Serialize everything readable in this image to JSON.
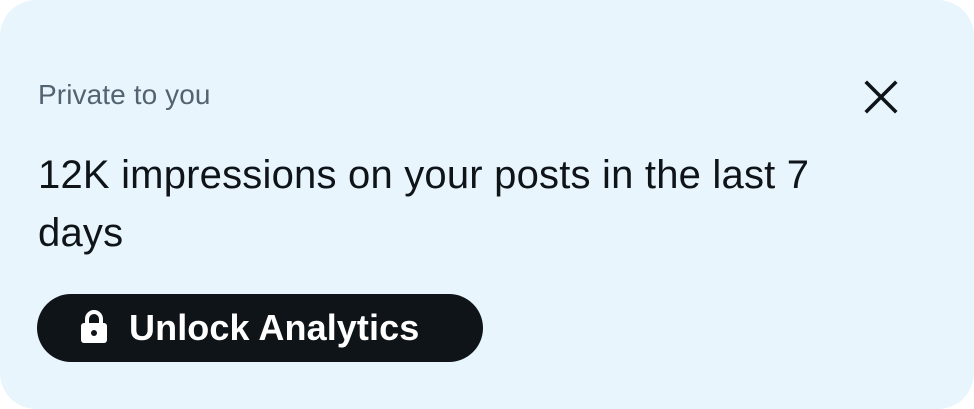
{
  "card": {
    "eyebrow": "Private to you",
    "headline": "12K impressions on your posts in the last 7 days",
    "close_icon": "close-icon",
    "unlock_button": {
      "label": "Unlock Analytics",
      "icon": "lock-icon"
    }
  },
  "colors": {
    "card_background": "#e8f5fd",
    "muted_text": "#536471",
    "primary_text": "#0f1419",
    "button_background": "#0f1419",
    "button_text": "#ffffff"
  }
}
